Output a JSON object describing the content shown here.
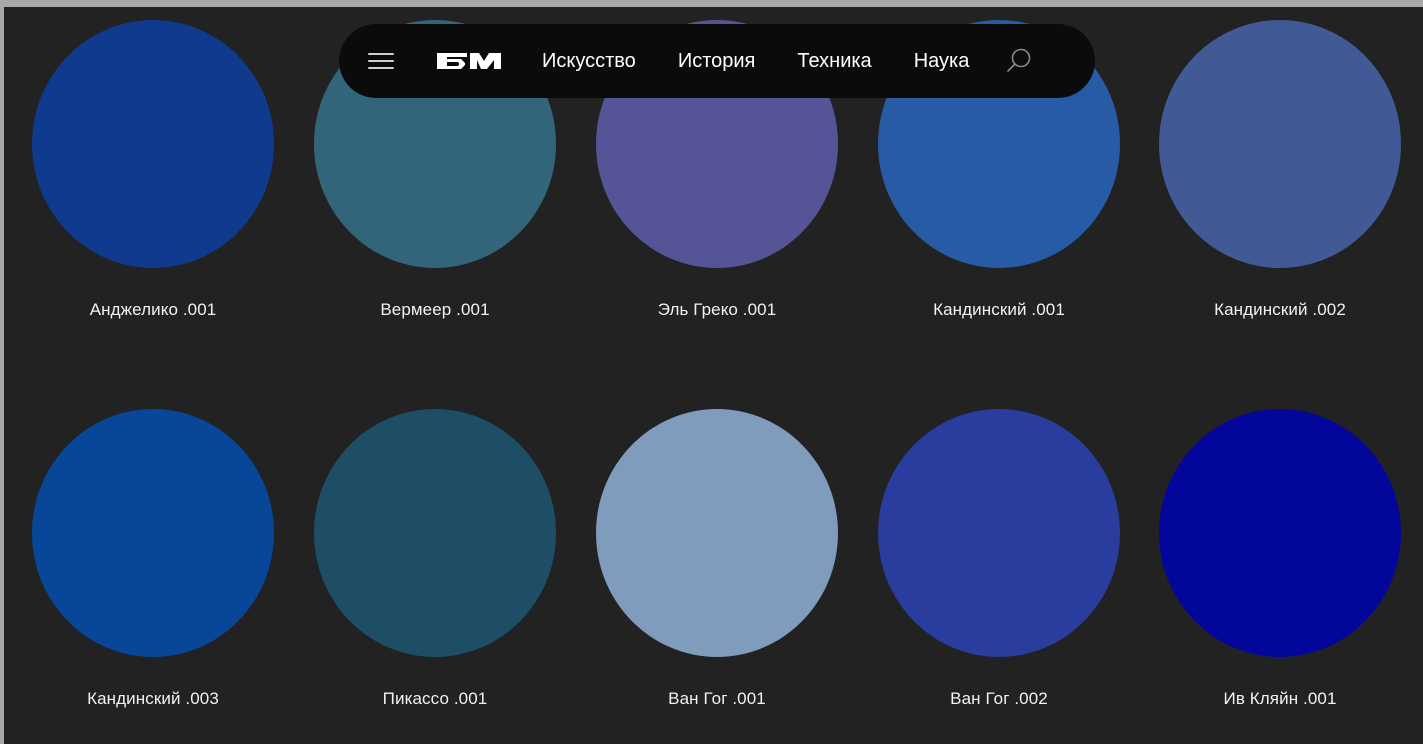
{
  "nav": {
    "menu_icon": "hamburger-menu-icon",
    "logo_text": "БМ",
    "links": [
      "Искусство",
      "История",
      "Техника",
      "Наука"
    ],
    "search_icon": "search-icon"
  },
  "swatches": [
    {
      "label": "Анджелико .001",
      "color": "#0f3a8e"
    },
    {
      "label": "Вермеер .001",
      "color": "#33657a"
    },
    {
      "label": "Эль Греко .001",
      "color": "#545497"
    },
    {
      "label": "Кандинский .001",
      "color": "#275ba6"
    },
    {
      "label": "Кандинский .002",
      "color": "#415995"
    },
    {
      "label": "Кандинский .003",
      "color": "#084697"
    },
    {
      "label": "Пикассо .001",
      "color": "#1e4e65"
    },
    {
      "label": "Ван Гог .001",
      "color": "#7f9cbc"
    },
    {
      "label": "Ван Гог .002",
      "color": "#283d9d"
    },
    {
      "label": "Ив Кляйн .001",
      "color": "#03069b"
    }
  ],
  "colors": {
    "page_background": "#222222",
    "navbar_background": "#0b0b0c",
    "text": "#f2f2f2"
  }
}
